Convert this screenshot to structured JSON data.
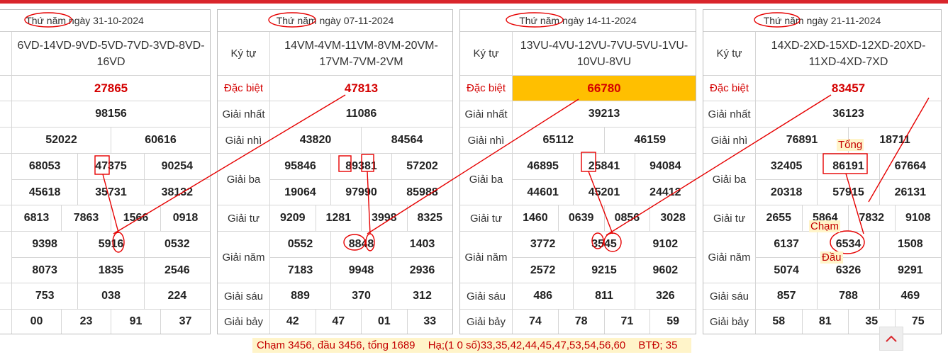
{
  "panels": [
    {
      "date_day": "Thứ năm",
      "date_rest": " ngày 31-10-2024",
      "labels": {
        "kytu": "tự",
        "db": "biệt",
        "g1": "nhất",
        "g2": "nhì",
        "g3": "i ba",
        "g4": "i tư",
        "g5": "năm",
        "g6": "sáu",
        "g7": "bảy"
      },
      "kytu": "6VD-14VD-9VD-5VD-7VD-3VD-8VD-16VD",
      "db": "27865",
      "g1": [
        "98156"
      ],
      "g2": [
        "52022",
        "60616"
      ],
      "g3a": [
        "68053",
        "47375",
        "90254"
      ],
      "g3b": [
        "45618",
        "35731",
        "38132"
      ],
      "g4": [
        "6813",
        "7863",
        "1566",
        "0918"
      ],
      "g5a": [
        "9398",
        "5916",
        "0532"
      ],
      "g5b": [
        "8073",
        "1835",
        "2546"
      ],
      "g6": [
        "753",
        "038",
        "224"
      ],
      "g7": [
        "00",
        "23",
        "91",
        "37"
      ]
    },
    {
      "date_day": "Thứ năm",
      "date_rest": " ngày 07-11-2024",
      "labels": {
        "kytu": "Ký tự",
        "db": "Đặc biệt",
        "g1": "Giải nhất",
        "g2": "Giải nhì",
        "g3": "Giải ba",
        "g4": "Giải tư",
        "g5": "Giải năm",
        "g6": "Giải sáu",
        "g7": "Giải bảy"
      },
      "kytu": "14VM-4VM-11VM-8VM-20VM-17VM-7VM-2VM",
      "db": "47813",
      "g1": [
        "11086"
      ],
      "g2": [
        "43820",
        "84564"
      ],
      "g3a": [
        "95846",
        "89381",
        "57202"
      ],
      "g3b": [
        "19064",
        "97990",
        "85988"
      ],
      "g4": [
        "9209",
        "1281",
        "3998",
        "8325"
      ],
      "g5a": [
        "0552",
        "8848",
        "1403"
      ],
      "g5b": [
        "7183",
        "9948",
        "2936"
      ],
      "g6": [
        "889",
        "370",
        "312"
      ],
      "g7": [
        "42",
        "47",
        "01",
        "33"
      ]
    },
    {
      "date_day": "Thứ năm",
      "date_rest": " ngày 14-11-2024",
      "labels": {
        "kytu": "Ký tự",
        "db": "Đặc biệt",
        "g1": "Giải nhất",
        "g2": "Giải nhì",
        "g3": "Giải ba",
        "g4": "Giải tư",
        "g5": "Giải năm",
        "g6": "Giải sáu",
        "g7": "Giải bảy"
      },
      "kytu": "13VU-4VU-12VU-7VU-5VU-1VU-10VU-8VU",
      "db": "66780",
      "g1": [
        "39213"
      ],
      "g2": [
        "65112",
        "46159"
      ],
      "g3a": [
        "46895",
        "25841",
        "94084"
      ],
      "g3b": [
        "44601",
        "45201",
        "24412"
      ],
      "g4": [
        "1460",
        "0639",
        "0856",
        "3028"
      ],
      "g5a": [
        "3772",
        "3545",
        "9102"
      ],
      "g5b": [
        "2572",
        "9215",
        "9602"
      ],
      "g6": [
        "486",
        "811",
        "326"
      ],
      "g7": [
        "74",
        "78",
        "71",
        "59"
      ]
    },
    {
      "date_day": "Thứ năm",
      "date_rest": " ngày 21-11-2024",
      "labels": {
        "kytu": "Ký tự",
        "db": "Đặc biệt",
        "g1": "Giải nhất",
        "g2": "Giải nhì",
        "g3": "Giải ba",
        "g4": "Giải tư",
        "g5": "Giải năm",
        "g6": "Giải sáu",
        "g7": "Giải bảy"
      },
      "kytu": "14XD-2XD-15XD-12XD-20XD-11XD-4XD-7XD",
      "db": "83457",
      "g1": [
        "36123"
      ],
      "g2": [
        "76891",
        "18711"
      ],
      "g3a": [
        "32405",
        "86191",
        "67664"
      ],
      "g3b": [
        "20318",
        "57915",
        "26131"
      ],
      "g4": [
        "2655",
        "5864",
        "7832",
        "9108"
      ],
      "g5a": [
        "6137",
        "6534",
        "1508"
      ],
      "g5b": [
        "5074",
        "6326",
        "9291"
      ],
      "g6": [
        "857",
        "788",
        "469"
      ],
      "g7": [
        "58",
        "81",
        "35",
        "75"
      ]
    }
  ],
  "annotations": {
    "tong": "Tổng",
    "cham": "Chạm",
    "dau": "Đầu"
  },
  "footer": {
    "part1": "Chạm 3456, đầu 3456, tổng 1689",
    "part2": "Hạ;(1 0 số)33,35,42,44,45,47,53,54,56,60",
    "part3": "BTĐ; 35"
  },
  "colors": {
    "accent": "#d9252b",
    "prize_red": "#d40000",
    "highlight": "#ffbf00",
    "annotation_bg": "#fff4c9"
  },
  "icons": {
    "scroll_top": "chevron-up-icon"
  }
}
